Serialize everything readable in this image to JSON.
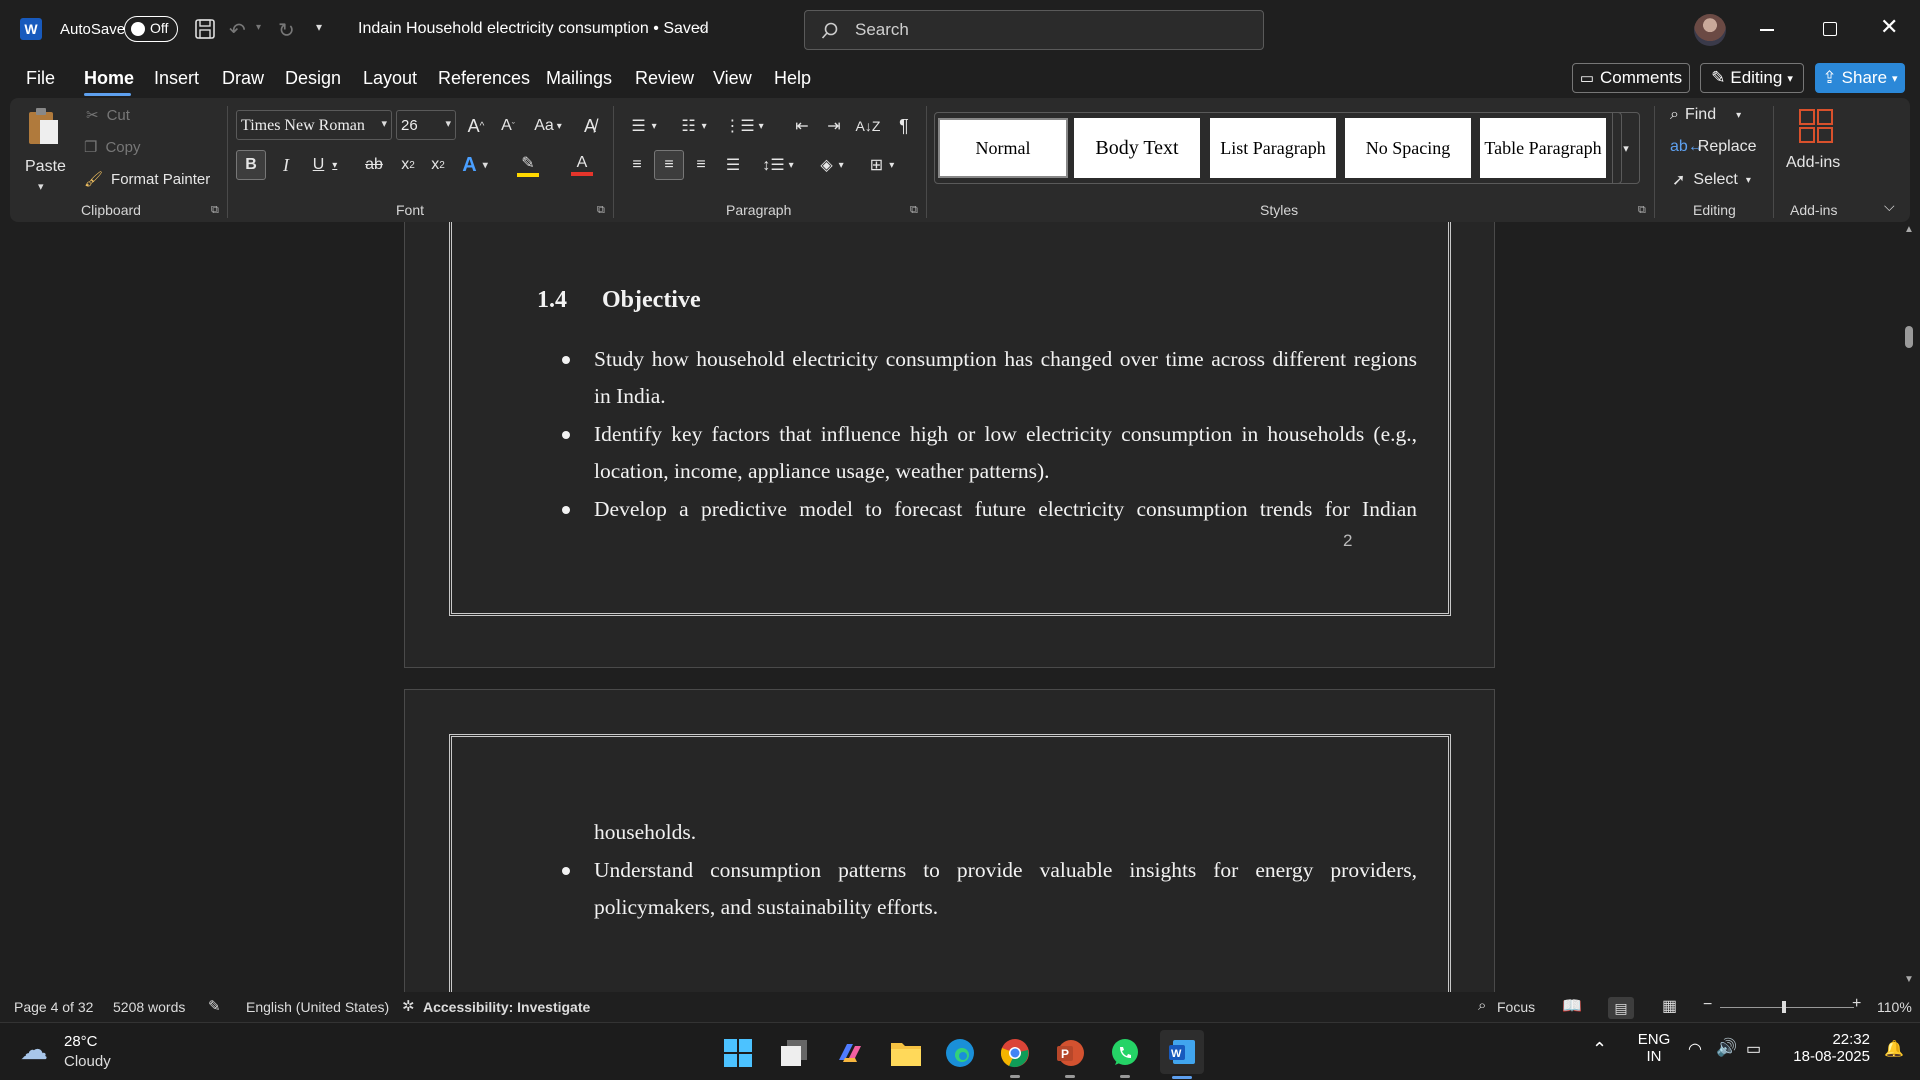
{
  "titlebar": {
    "autosave_label": "AutoSave",
    "autosave_state": "Off",
    "doc_title": "Indain Household electricity consumption • Saved",
    "search_placeholder": "Search",
    "window_controls": [
      "minimize-icon",
      "restore-icon",
      "close-icon"
    ]
  },
  "tabs": [
    "File",
    "Home",
    "Insert",
    "Draw",
    "Design",
    "Layout",
    "References",
    "Mailings",
    "Review",
    "View",
    "Help"
  ],
  "active_tab": "Home",
  "right_actions": {
    "comments": "Comments",
    "editing": "Editing",
    "share": "Share"
  },
  "ribbon": {
    "clipboard": {
      "paste": "Paste",
      "cut": "Cut",
      "copy": "Copy",
      "format_painter": "Format Painter",
      "label": "Clipboard"
    },
    "font": {
      "family": "Times New Roman",
      "size": "26",
      "label": "Font"
    },
    "paragraph": {
      "label": "Paragraph"
    },
    "styles": {
      "items": [
        "Normal",
        "Body Text",
        "List Paragraph",
        "No Spacing",
        "Table Paragraph"
      ],
      "label": "Styles"
    },
    "editing": {
      "find": "Find",
      "replace": "Replace",
      "select": "Select",
      "label": "Editing"
    },
    "addins": {
      "button": "Add-ins",
      "label": "Add-ins"
    }
  },
  "document": {
    "heading_number": "1.4",
    "heading_text": "Objective",
    "bullet1_line1": "Study how household electricity consumption has changed over time across different regions",
    "bullet1_line2": "in India.",
    "bullet2_line1": "Identify key factors that influence high or low electricity consumption in households (e.g.,",
    "bullet2_line2": "location, income, appliance usage, weather patterns).",
    "bullet3_line1": "Develop a predictive model to forecast future electricity consumption trends for Indian",
    "page_number": "2",
    "bullet3_line2": "households.",
    "bullet4_line1": "Understand consumption patterns to provide valuable insights for energy providers,",
    "bullet4_line2": "policymakers, and sustainability efforts."
  },
  "statusbar": {
    "page": "Page 4 of 32",
    "words": "5208 words",
    "language": "English (United States)",
    "accessibility": "Accessibility: Investigate",
    "focus": "Focus",
    "zoom": "110%"
  },
  "taskbar": {
    "weather_temp": "28°C",
    "weather_desc": "Cloudy",
    "lang_line1": "ENG",
    "lang_line2": "IN",
    "time": "22:32",
    "date": "18-08-2025"
  },
  "colors": {
    "accent": "#0f6cbd",
    "share": "#2b88d8",
    "background": "#1f1f1f",
    "ribbon": "#2b2b2b",
    "page": "#262626"
  }
}
